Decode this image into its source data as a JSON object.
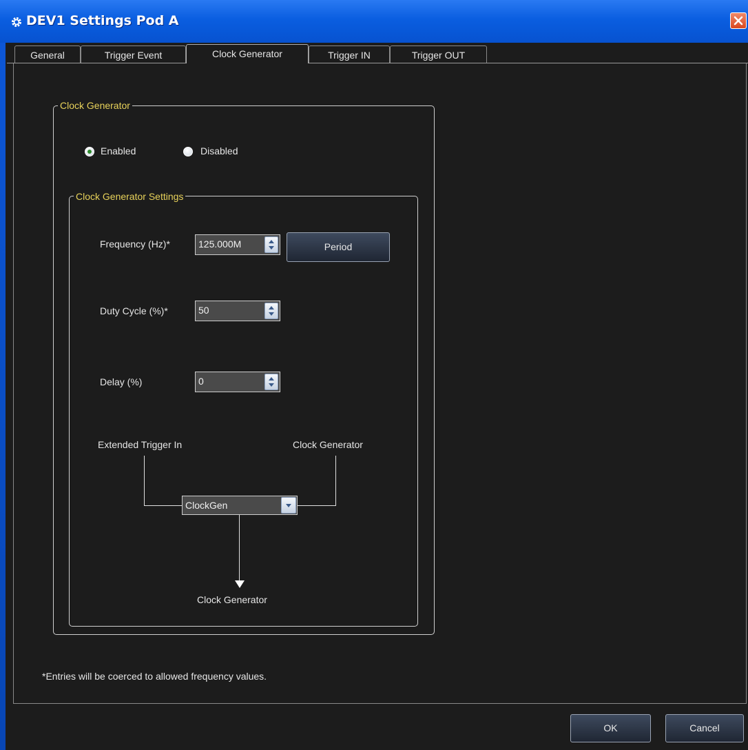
{
  "window": {
    "title": "DEV1 Settings Pod A"
  },
  "tabs": [
    {
      "label": "General"
    },
    {
      "label": "Trigger Event"
    },
    {
      "label": "Clock Generator"
    },
    {
      "label": "Trigger IN"
    },
    {
      "label": "Trigger OUT"
    }
  ],
  "active_tab": "Clock Generator",
  "clock_generator": {
    "group_title": "Clock Generator",
    "enabled_label": "Enabled",
    "disabled_label": "Disabled",
    "selected": "Enabled"
  },
  "settings": {
    "group_title": "Clock Generator Settings",
    "frequency_label": "Frequency (Hz)*",
    "frequency_value": "125.000M",
    "period_button": "Period",
    "duty_label": "Duty Cycle (%)*",
    "duty_value": "50",
    "delay_label": "Delay (%)",
    "delay_value": "0"
  },
  "routing": {
    "left_source": "Extended Trigger In",
    "right_source": "Clock Generator",
    "selector_value": "ClockGen",
    "output_label": "Clock Generator"
  },
  "footnote": "*Entries will be coerced to allowed frequency values.",
  "buttons": {
    "ok": "OK",
    "cancel": "Cancel"
  },
  "colors": {
    "titlebar": "#0a5ee0",
    "background": "#1c1c1c",
    "group_title": "#e8d25a",
    "close": "#d9471f"
  }
}
